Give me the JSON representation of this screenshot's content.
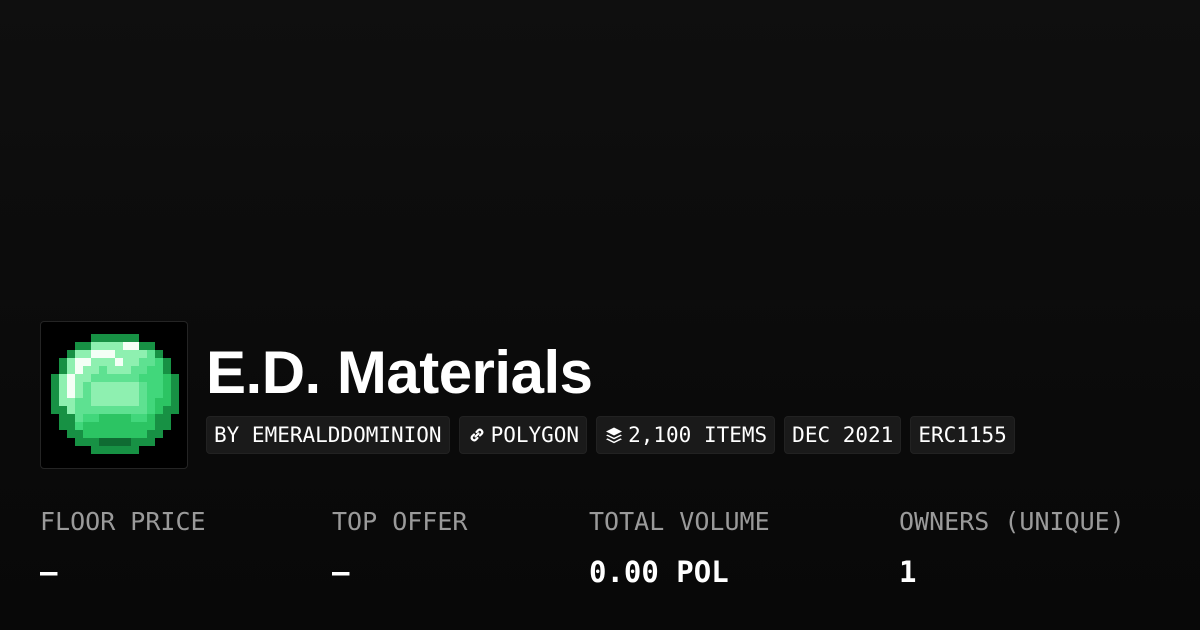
{
  "collection": {
    "name": "E.D. Materials",
    "avatar_icon": "emerald-gem-icon"
  },
  "chips": {
    "creator": "BY EMERALDDOMINION",
    "chain": "POLYGON",
    "chain_icon": "chain-link-icon",
    "items": "2,100 ITEMS",
    "items_icon": "layers-icon",
    "date": "DEC 2021",
    "standard": "ERC1155"
  },
  "stats": {
    "floor_price": {
      "label": "FLOOR PRICE",
      "value": "–"
    },
    "top_offer": {
      "label": "TOP OFFER",
      "value": "–"
    },
    "total_volume": {
      "label": "TOTAL VOLUME",
      "value": "0.00 POL"
    },
    "owners": {
      "label": "OWNERS (UNIQUE)",
      "value": "1"
    }
  },
  "colors": {
    "background": "#0b0b0b",
    "chip_background": "#1a1a1a",
    "label": "#9a9a9a",
    "emerald_light": "#8ef0b0",
    "emerald_mid": "#41d77b",
    "emerald_dark": "#179144"
  }
}
